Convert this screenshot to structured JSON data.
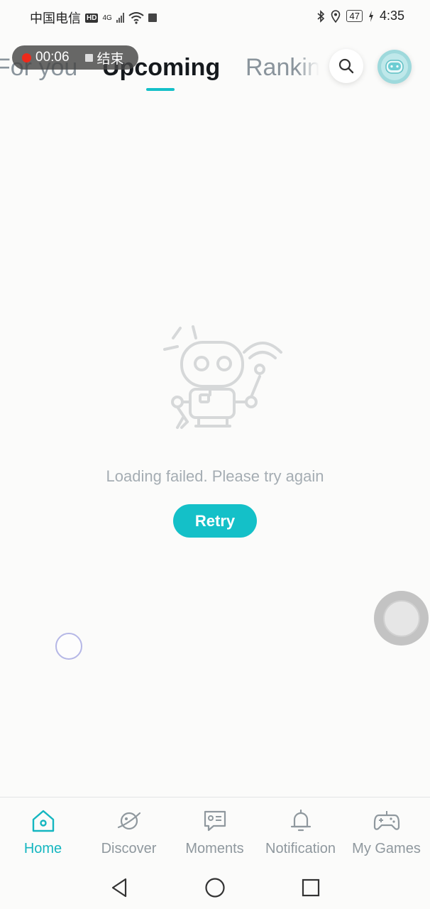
{
  "status_bar": {
    "carrier": "中国电信",
    "hd": "HD",
    "network": "4G",
    "battery": "47",
    "time": "4:35"
  },
  "recording": {
    "time": "00:06",
    "stop_label": "结束"
  },
  "tabs": [
    {
      "label": "For you"
    },
    {
      "label": "Upcoming"
    },
    {
      "label": "Ranking"
    }
  ],
  "empty_state": {
    "message": "Loading failed. Please try again",
    "retry_label": "Retry"
  },
  "bottom_nav": [
    {
      "label": "Home",
      "icon": "home-icon",
      "active": true
    },
    {
      "label": "Discover",
      "icon": "planet-icon"
    },
    {
      "label": "Moments",
      "icon": "chat-icon"
    },
    {
      "label": "Notification",
      "icon": "bell-icon"
    },
    {
      "label": "My Games",
      "icon": "gamepad-icon"
    }
  ],
  "colors": {
    "accent": "#14c0c8",
    "inactive_text": "#8f989e",
    "background": "#fbfbfa"
  }
}
